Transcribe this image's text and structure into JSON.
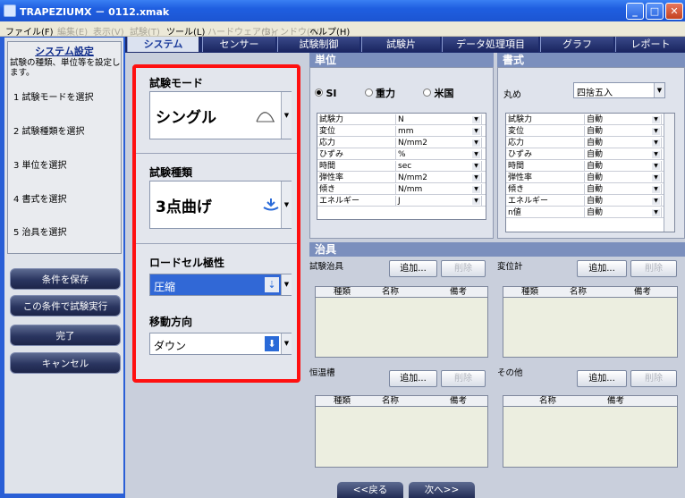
{
  "window": {
    "title": "TRAPEZIUMX － 0112.xmak",
    "min": "_",
    "max": "□",
    "close": "✕"
  },
  "menu": [
    {
      "label": "ファイル(F)",
      "enabled": true
    },
    {
      "label": "編集(E)",
      "enabled": false
    },
    {
      "label": "表示(V)",
      "enabled": false
    },
    {
      "label": "試験(T)",
      "enabled": false
    },
    {
      "label": "ツール(L)",
      "enabled": true
    },
    {
      "label": "ハードウェア(B)",
      "enabled": false
    },
    {
      "label": "ウィンドウ(W)",
      "enabled": false
    },
    {
      "label": "ヘルプ(H)",
      "enabled": true
    }
  ],
  "sidebar": {
    "title": "システム設定",
    "description": "試験の種類、単位等を設定します。",
    "steps": [
      "1  試験モードを選択",
      "2  試験種類を選択",
      "3  単位を選択",
      "4  書式を選択",
      "5  治具を選択"
    ],
    "buttons": [
      "条件を保存",
      "この条件で試験実行",
      "完了",
      "キャンセル"
    ]
  },
  "tabs": [
    "システム",
    "センサー",
    "試験制御",
    "試験片",
    "データ処理項目",
    "グラフ",
    "レポート"
  ],
  "mode_panel": {
    "test_mode_label": "試験モード",
    "test_mode_value": "シングル",
    "test_type_label": "試験種類",
    "test_type_value": "3点曲げ",
    "loadcell_label": "ロードセル極性",
    "loadcell_value": "圧縮",
    "direction_label": "移動方向",
    "direction_value": "ダウン"
  },
  "units": {
    "header": "単位",
    "radios": [
      {
        "label": "SI",
        "on": true
      },
      {
        "label": "重力",
        "on": false
      },
      {
        "label": "米国",
        "on": false
      }
    ],
    "rows": [
      [
        "試験力",
        "N"
      ],
      [
        "変位",
        "mm"
      ],
      [
        "応力",
        "N/mm2"
      ],
      [
        "ひずみ",
        "%"
      ],
      [
        "時間",
        "sec"
      ],
      [
        "弾性率",
        "N/mm2"
      ],
      [
        "傾き",
        "N/mm"
      ],
      [
        "エネルギー",
        "J"
      ]
    ]
  },
  "format": {
    "header": "書式",
    "rounding_label": "丸め",
    "rounding_value": "四捨五入",
    "rows": [
      [
        "試験力",
        "自動"
      ],
      [
        "変位",
        "自動"
      ],
      [
        "応力",
        "自動"
      ],
      [
        "ひずみ",
        "自動"
      ],
      [
        "時間",
        "自動"
      ],
      [
        "弾性率",
        "自動"
      ],
      [
        "傾き",
        "自動"
      ],
      [
        "エネルギー",
        "自動"
      ],
      [
        "n値",
        "自動"
      ]
    ]
  },
  "jig": {
    "header": "治具",
    "add": "追加...",
    "delete": "削除",
    "test_jig": {
      "label": "試験治具",
      "cols": [
        "種類",
        "名称",
        "備考"
      ]
    },
    "displacement": {
      "label": "変位計",
      "cols": [
        "種類",
        "名称",
        "備考"
      ]
    },
    "chamber": {
      "label": "恒温槽",
      "cols": [
        "種類",
        "名称",
        "備考"
      ]
    },
    "other": {
      "label": "その他",
      "cols": [
        "名称",
        "備考"
      ]
    }
  },
  "footer": {
    "prev": "<<戻る",
    "next": "次へ>>"
  }
}
